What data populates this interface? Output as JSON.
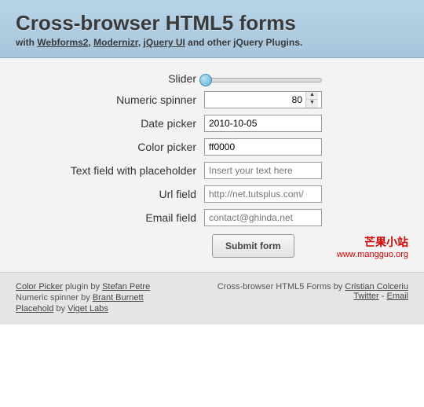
{
  "header": {
    "title": "Cross-browser HTML5 forms",
    "sub_prefix": "with ",
    "sub_links": [
      "Webforms2",
      "Modernizr",
      "jQuery UI"
    ],
    "sub_suffix": " and other jQuery Plugins."
  },
  "form": {
    "slider": {
      "label": "Slider"
    },
    "spinner": {
      "label": "Numeric spinner",
      "value": "80"
    },
    "date": {
      "label": "Date picker",
      "value": "2010-10-05"
    },
    "color": {
      "label": "Color picker",
      "value": "ff0000"
    },
    "text": {
      "label": "Text field with placeholder",
      "placeholder": "Insert your text here"
    },
    "url": {
      "label": "Url field",
      "placeholder": "http://net.tutsplus.com/"
    },
    "email": {
      "label": "Email field",
      "placeholder": "contact@ghinda.net"
    },
    "submit": "Submit form"
  },
  "watermark": {
    "cn": "芒果小站",
    "url": "www.mangguo.org"
  },
  "footer": {
    "left": {
      "cp_plugin": "Color Picker",
      "cp_by": " plugin by ",
      "cp_author": "Stefan Petre",
      "ns_label": "Numeric spinner by ",
      "ns_author": "Brant Burnett",
      "ph_label": "Placehold",
      "ph_by": " by ",
      "ph_author": "Viget Labs"
    },
    "right": {
      "credit": "Cross-browser HTML5 Forms by ",
      "author": "Cristian Colceriu",
      "twitter": "Twitter",
      "sep": " - ",
      "email": "Email"
    }
  }
}
